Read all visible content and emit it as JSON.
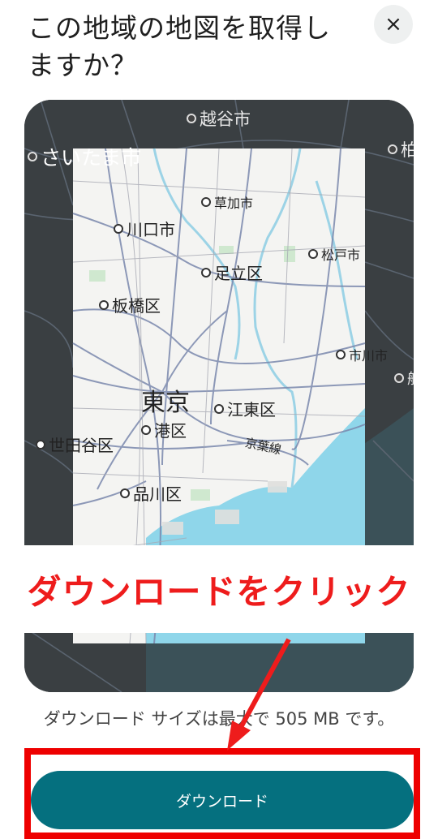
{
  "dialog": {
    "title": "この地域の地図を取得しますか？",
    "close_label": "×"
  },
  "map": {
    "labels": {
      "koshigaya": "越谷市",
      "saitama": "さいたま市",
      "kashiwa": "柏",
      "soka": "草加市",
      "kawaguchi": "川口市",
      "matsudo": "松戸市",
      "adachi": "足立区",
      "itabashi": "板橋区",
      "ichikawa": "市川市",
      "funabashi": "船",
      "tokyo": "東京",
      "koto": "江東区",
      "minato": "港区",
      "setagaya": "世田谷区",
      "keiyo": "京葉線",
      "shinagawa": "品川区"
    }
  },
  "annotation": {
    "text": "ダウンロードをクリック"
  },
  "download": {
    "size_text": "ダウンロード サイズは最大で 505 MB です。",
    "button_label": "ダウンロード"
  },
  "colors": {
    "button": "#05707f",
    "annotation": "#ee1c1c",
    "water": "#8fd6ea"
  }
}
